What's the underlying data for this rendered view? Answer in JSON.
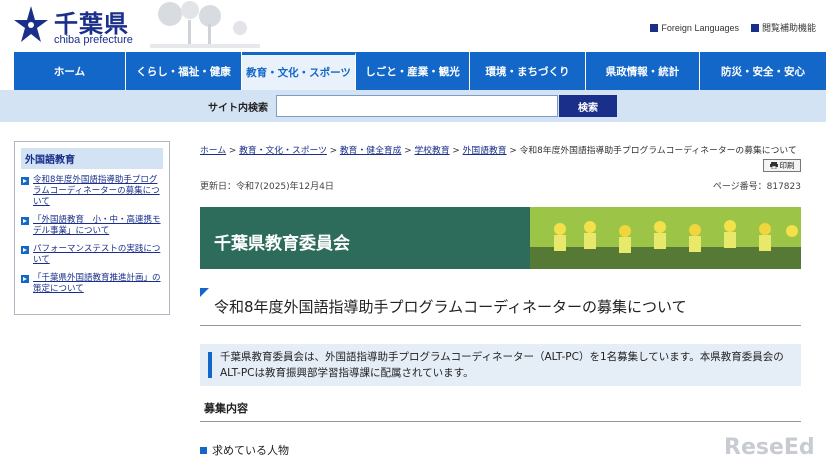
{
  "header": {
    "logo_title": "千葉県",
    "logo_sub": "chiba prefecture",
    "util_links": [
      "Foreign Languages",
      "閲覧補助機能"
    ]
  },
  "gnav": [
    "ホーム",
    "くらし・福祉・健康",
    "教育・文化・スポーツ",
    "しごと・産業・観光",
    "環境・まちづくり",
    "県政情報・統計",
    "防災・安全・安心"
  ],
  "search": {
    "label": "サイト内検索",
    "placeholder": "",
    "button": "検索"
  },
  "sidebar": {
    "title": "外国語教育",
    "items": [
      "令和8年度外国語指導助手プログラムコーディネーターの募集について",
      "「外国語教育　小・中・高連携モデル事業」について",
      "パフォーマンステストの実践について",
      "「千葉県外国語教育推進計画」の策定について"
    ]
  },
  "breadcrumb": {
    "links": [
      "ホーム",
      "教育・文化・スポーツ",
      "教育・健全育成",
      "学校教育",
      "外国語教育"
    ],
    "current": "令和8年度外国語指導助手プログラムコーディネーターの募集について"
  },
  "print_label": "印刷",
  "updated": "更新日：令和7(2025)年12月4日",
  "page_no": "ページ番号：817823",
  "banner_title": "千葉県教育委員会",
  "page_title": "令和8年度外国語指導助手プログラムコーディネーターの募集について",
  "lead": "千葉県教育委員会は、外国語指導助手プログラムコーディネーター（ALT-PC）を1名募集しています。本県教育委員会のALT-PCは教育振興部学習指導課に配属されています。",
  "section_heading": "募集内容",
  "subsection_heading": "求めている人物",
  "watermark": "ReseEd",
  "colors": {
    "nav_blue": "#1367c8",
    "brand_navy": "#1a2f8a",
    "search_bg": "#d3e3f4"
  }
}
